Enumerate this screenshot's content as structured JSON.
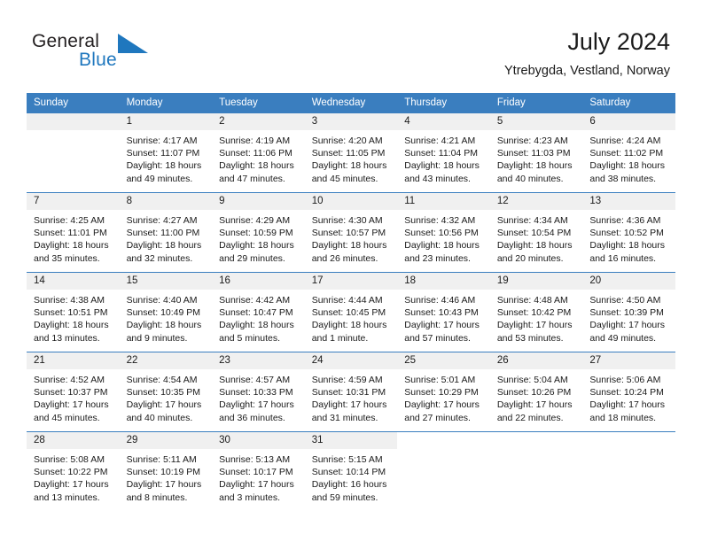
{
  "brand": {
    "name_part1": "General",
    "name_part2": "Blue",
    "mark": "triangle-logo-icon"
  },
  "header": {
    "title": "July 2024",
    "subtitle": "Ytrebygda, Vestland, Norway"
  },
  "colors": {
    "header_blue": "#3a7ebf",
    "brand_blue": "#1f77be",
    "daynum_bg": "#f0f0f0",
    "text": "#1a1a1a"
  },
  "weekdays": [
    "Sunday",
    "Monday",
    "Tuesday",
    "Wednesday",
    "Thursday",
    "Friday",
    "Saturday"
  ],
  "weeks": [
    [
      {
        "day": "",
        "empty": true,
        "lines": []
      },
      {
        "day": "1",
        "lines": [
          "Sunrise: 4:17 AM",
          "Sunset: 11:07 PM",
          "Daylight: 18 hours",
          "and 49 minutes."
        ]
      },
      {
        "day": "2",
        "lines": [
          "Sunrise: 4:19 AM",
          "Sunset: 11:06 PM",
          "Daylight: 18 hours",
          "and 47 minutes."
        ]
      },
      {
        "day": "3",
        "lines": [
          "Sunrise: 4:20 AM",
          "Sunset: 11:05 PM",
          "Daylight: 18 hours",
          "and 45 minutes."
        ]
      },
      {
        "day": "4",
        "lines": [
          "Sunrise: 4:21 AM",
          "Sunset: 11:04 PM",
          "Daylight: 18 hours",
          "and 43 minutes."
        ]
      },
      {
        "day": "5",
        "lines": [
          "Sunrise: 4:23 AM",
          "Sunset: 11:03 PM",
          "Daylight: 18 hours",
          "and 40 minutes."
        ]
      },
      {
        "day": "6",
        "lines": [
          "Sunrise: 4:24 AM",
          "Sunset: 11:02 PM",
          "Daylight: 18 hours",
          "and 38 minutes."
        ]
      }
    ],
    [
      {
        "day": "7",
        "lines": [
          "Sunrise: 4:25 AM",
          "Sunset: 11:01 PM",
          "Daylight: 18 hours",
          "and 35 minutes."
        ]
      },
      {
        "day": "8",
        "lines": [
          "Sunrise: 4:27 AM",
          "Sunset: 11:00 PM",
          "Daylight: 18 hours",
          "and 32 minutes."
        ]
      },
      {
        "day": "9",
        "lines": [
          "Sunrise: 4:29 AM",
          "Sunset: 10:59 PM",
          "Daylight: 18 hours",
          "and 29 minutes."
        ]
      },
      {
        "day": "10",
        "lines": [
          "Sunrise: 4:30 AM",
          "Sunset: 10:57 PM",
          "Daylight: 18 hours",
          "and 26 minutes."
        ]
      },
      {
        "day": "11",
        "lines": [
          "Sunrise: 4:32 AM",
          "Sunset: 10:56 PM",
          "Daylight: 18 hours",
          "and 23 minutes."
        ]
      },
      {
        "day": "12",
        "lines": [
          "Sunrise: 4:34 AM",
          "Sunset: 10:54 PM",
          "Daylight: 18 hours",
          "and 20 minutes."
        ]
      },
      {
        "day": "13",
        "lines": [
          "Sunrise: 4:36 AM",
          "Sunset: 10:52 PM",
          "Daylight: 18 hours",
          "and 16 minutes."
        ]
      }
    ],
    [
      {
        "day": "14",
        "lines": [
          "Sunrise: 4:38 AM",
          "Sunset: 10:51 PM",
          "Daylight: 18 hours",
          "and 13 minutes."
        ]
      },
      {
        "day": "15",
        "lines": [
          "Sunrise: 4:40 AM",
          "Sunset: 10:49 PM",
          "Daylight: 18 hours",
          "and 9 minutes."
        ]
      },
      {
        "day": "16",
        "lines": [
          "Sunrise: 4:42 AM",
          "Sunset: 10:47 PM",
          "Daylight: 18 hours",
          "and 5 minutes."
        ]
      },
      {
        "day": "17",
        "lines": [
          "Sunrise: 4:44 AM",
          "Sunset: 10:45 PM",
          "Daylight: 18 hours",
          "and 1 minute."
        ]
      },
      {
        "day": "18",
        "lines": [
          "Sunrise: 4:46 AM",
          "Sunset: 10:43 PM",
          "Daylight: 17 hours",
          "and 57 minutes."
        ]
      },
      {
        "day": "19",
        "lines": [
          "Sunrise: 4:48 AM",
          "Sunset: 10:42 PM",
          "Daylight: 17 hours",
          "and 53 minutes."
        ]
      },
      {
        "day": "20",
        "lines": [
          "Sunrise: 4:50 AM",
          "Sunset: 10:39 PM",
          "Daylight: 17 hours",
          "and 49 minutes."
        ]
      }
    ],
    [
      {
        "day": "21",
        "lines": [
          "Sunrise: 4:52 AM",
          "Sunset: 10:37 PM",
          "Daylight: 17 hours",
          "and 45 minutes."
        ]
      },
      {
        "day": "22",
        "lines": [
          "Sunrise: 4:54 AM",
          "Sunset: 10:35 PM",
          "Daylight: 17 hours",
          "and 40 minutes."
        ]
      },
      {
        "day": "23",
        "lines": [
          "Sunrise: 4:57 AM",
          "Sunset: 10:33 PM",
          "Daylight: 17 hours",
          "and 36 minutes."
        ]
      },
      {
        "day": "24",
        "lines": [
          "Sunrise: 4:59 AM",
          "Sunset: 10:31 PM",
          "Daylight: 17 hours",
          "and 31 minutes."
        ]
      },
      {
        "day": "25",
        "lines": [
          "Sunrise: 5:01 AM",
          "Sunset: 10:29 PM",
          "Daylight: 17 hours",
          "and 27 minutes."
        ]
      },
      {
        "day": "26",
        "lines": [
          "Sunrise: 5:04 AM",
          "Sunset: 10:26 PM",
          "Daylight: 17 hours",
          "and 22 minutes."
        ]
      },
      {
        "day": "27",
        "lines": [
          "Sunrise: 5:06 AM",
          "Sunset: 10:24 PM",
          "Daylight: 17 hours",
          "and 18 minutes."
        ]
      }
    ],
    [
      {
        "day": "28",
        "lines": [
          "Sunrise: 5:08 AM",
          "Sunset: 10:22 PM",
          "Daylight: 17 hours",
          "and 13 minutes."
        ]
      },
      {
        "day": "29",
        "lines": [
          "Sunrise: 5:11 AM",
          "Sunset: 10:19 PM",
          "Daylight: 17 hours",
          "and 8 minutes."
        ]
      },
      {
        "day": "30",
        "lines": [
          "Sunrise: 5:13 AM",
          "Sunset: 10:17 PM",
          "Daylight: 17 hours",
          "and 3 minutes."
        ]
      },
      {
        "day": "31",
        "lines": [
          "Sunrise: 5:15 AM",
          "Sunset: 10:14 PM",
          "Daylight: 16 hours",
          "and 59 minutes."
        ]
      },
      {
        "day": "",
        "empty": true,
        "blank": true,
        "lines": []
      },
      {
        "day": "",
        "empty": true,
        "blank": true,
        "lines": []
      },
      {
        "day": "",
        "empty": true,
        "blank": true,
        "lines": []
      }
    ]
  ]
}
